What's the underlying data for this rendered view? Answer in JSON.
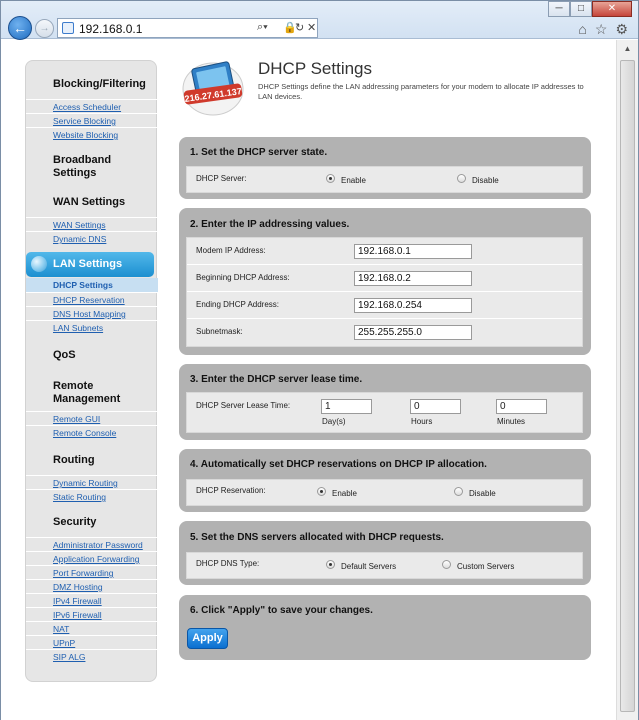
{
  "browser": {
    "url": "192.168.0.1",
    "window_buttons": [
      "─",
      "□",
      "✕"
    ]
  },
  "header": {
    "title": "DHCP Settings",
    "description": "DHCP Settings define the LAN addressing parameters for your modem to allocate IP addresses to LAN devices.",
    "logo_text": "216.27.61.137"
  },
  "sidebar": {
    "blocking": {
      "heading": "Blocking/Filtering",
      "links": [
        "Access Scheduler",
        "Service Blocking",
        "Website Blocking"
      ]
    },
    "broadband": {
      "heading": "Broadband Settings"
    },
    "wan": {
      "heading": "WAN Settings",
      "links": [
        "WAN Settings",
        "Dynamic DNS"
      ]
    },
    "lan": {
      "heading": "LAN Settings",
      "current": "DHCP Settings",
      "links": [
        "DHCP Reservation",
        "DNS Host Mapping",
        "LAN Subnets"
      ]
    },
    "qos": {
      "heading": "QoS"
    },
    "remote": {
      "heading": "Remote Management",
      "links": [
        "Remote GUI",
        "Remote Console"
      ]
    },
    "routing": {
      "heading": "Routing",
      "links": [
        "Dynamic Routing",
        "Static Routing"
      ]
    },
    "security": {
      "heading": "Security",
      "links": [
        "Administrator Password",
        "Application Forwarding",
        "Port Forwarding",
        "DMZ Hosting",
        "IPv4 Firewall",
        "IPv6 Firewall",
        "NAT",
        "UPnP",
        "SIP ALG"
      ]
    }
  },
  "section1": {
    "title": "1. Set the DHCP server state.",
    "label": "DHCP Server:",
    "options": [
      "Enable",
      "Disable"
    ],
    "selected": "Enable"
  },
  "section2": {
    "title": "2. Enter the IP addressing values.",
    "fields": [
      {
        "label": "Modem IP Address:",
        "value": "192.168.0.1"
      },
      {
        "label": "Beginning DHCP Address:",
        "value": "192.168.0.2"
      },
      {
        "label": "Ending DHCP Address:",
        "value": "192.168.0.254"
      },
      {
        "label": "Subnetmask:",
        "value": "255.255.255.0"
      }
    ]
  },
  "section3": {
    "title": "3. Enter the DHCP server lease time.",
    "label": "DHCP Server Lease Time:",
    "days": {
      "value": "1",
      "unit": "Day(s)"
    },
    "hours": {
      "value": "0",
      "unit": "Hours"
    },
    "minutes": {
      "value": "0",
      "unit": "Minutes"
    }
  },
  "section4": {
    "title": "4. Automatically set DHCP reservations on DHCP IP allocation.",
    "label": "DHCP Reservation:",
    "options": [
      "Enable",
      "Disable"
    ],
    "selected": "Enable"
  },
  "section5": {
    "title": "5. Set the DNS servers allocated with DHCP requests.",
    "label": "DHCP DNS Type:",
    "options": [
      "Default Servers",
      "Custom Servers"
    ],
    "selected": "Default Servers"
  },
  "section6": {
    "title": "6. Click \"Apply\" to save your changes.",
    "apply_label": "Apply"
  }
}
